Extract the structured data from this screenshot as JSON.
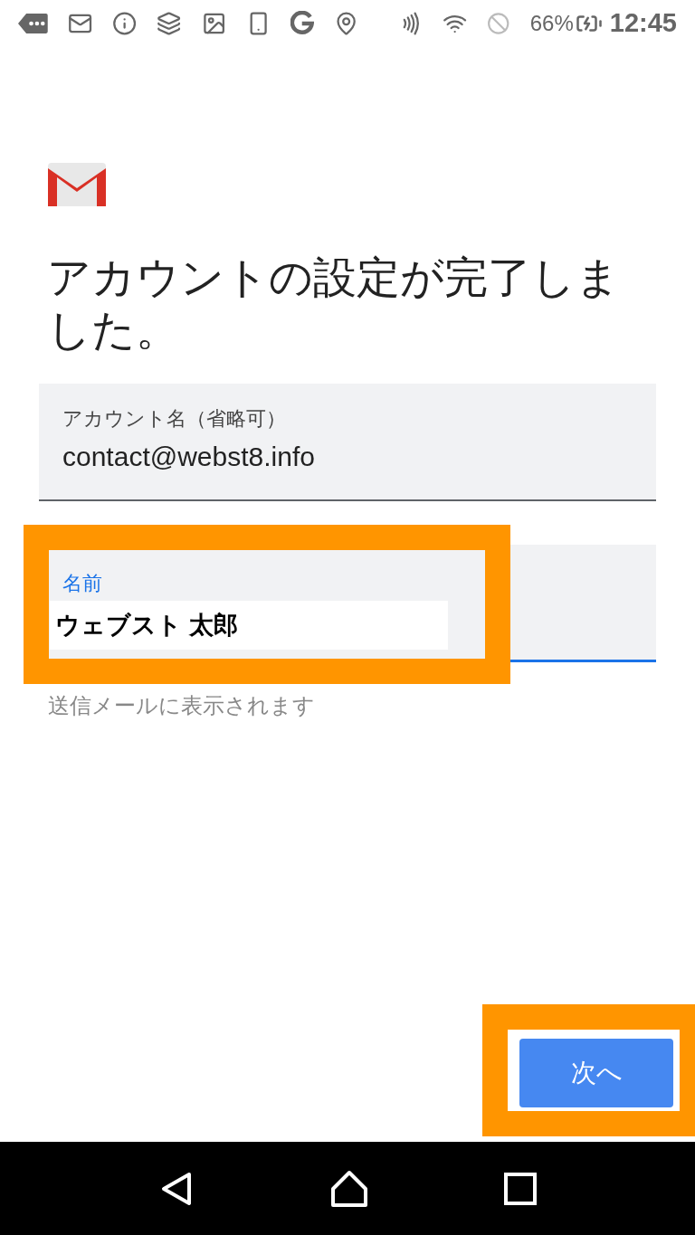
{
  "status_bar": {
    "battery": "66%",
    "time": "12:45"
  },
  "title": "アカウントの設定が完了しました。",
  "fields": [
    {
      "label": "アカウント名（省略可）",
      "value": "contact@webst8.info",
      "focused": false
    },
    {
      "label": "名前",
      "value": "ウェブスト 太郎",
      "focused": true,
      "helper": "送信メールに表示されます"
    }
  ],
  "next_button": "次へ"
}
